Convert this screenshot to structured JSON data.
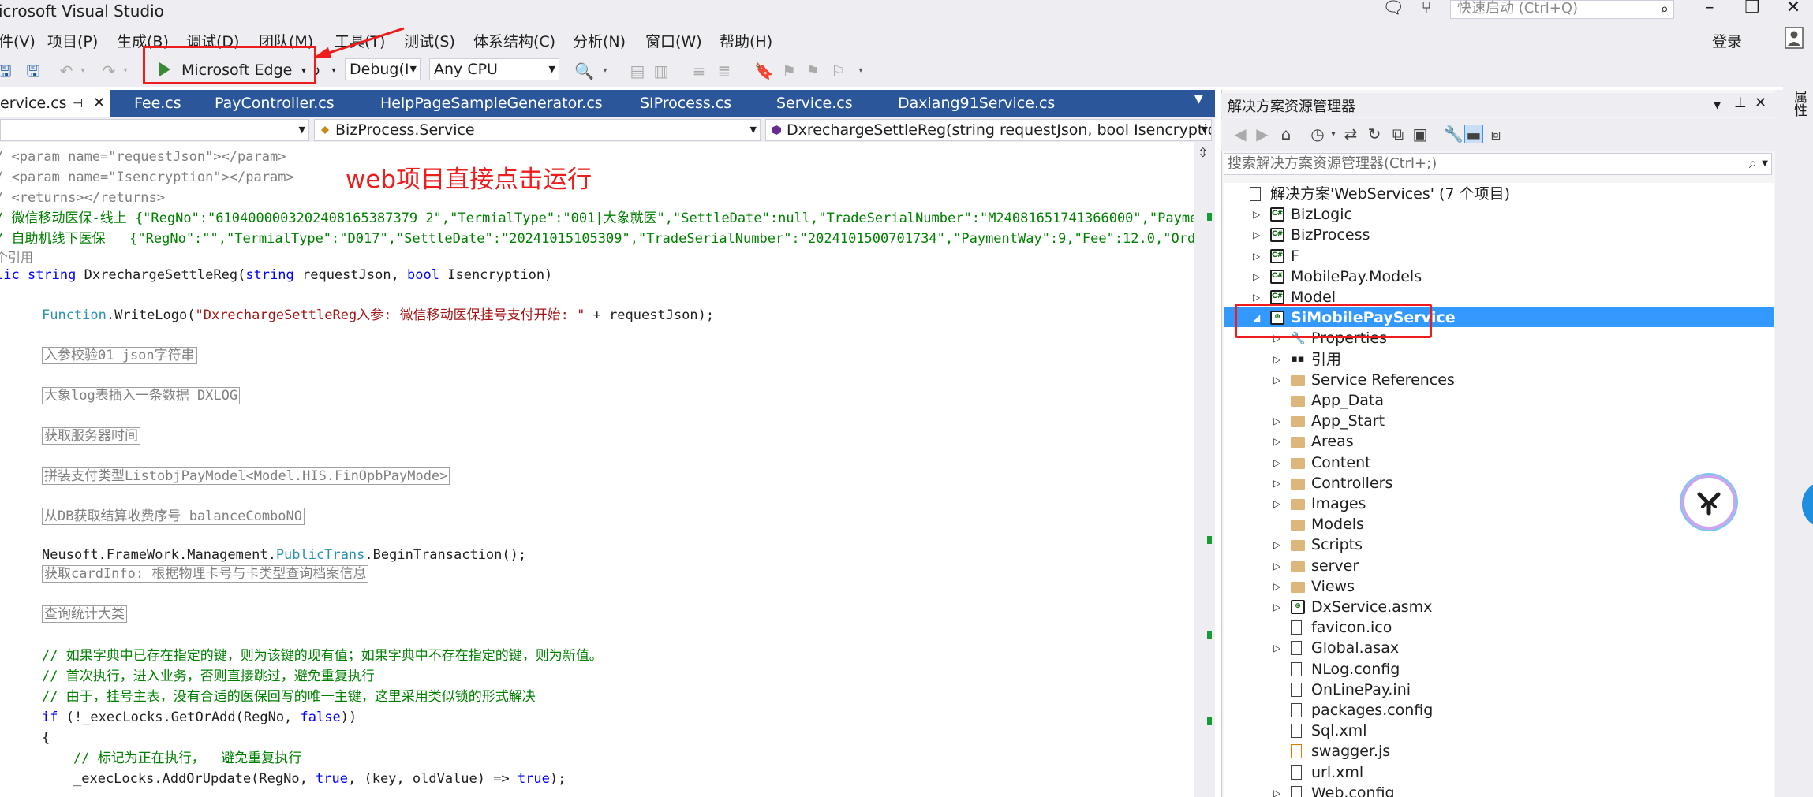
{
  "window": {
    "title": "icrosoft Visual Studio",
    "quick_launch_placeholder": "快速启动 (Ctrl+Q)",
    "login": "登录"
  },
  "menu": [
    "件(V)",
    "项目(P)",
    "生成(B)",
    "调试(D)",
    "团队(M)",
    "工具(T)",
    "测试(S)",
    "体系结构(C)",
    "分析(N)",
    "窗口(W)",
    "帮助(H)"
  ],
  "toolbar": {
    "run_label": "Microsoft Edge",
    "config": "Debug(I",
    "platform": "Any CPU"
  },
  "annotation": "web项目直接点击运行",
  "tabs": [
    "ervice.cs",
    "Fee.cs",
    "PayController.cs",
    "HelpPageSampleGenerator.cs",
    "SIProcess.cs",
    "Service.cs",
    "Daxiang91Service.cs"
  ],
  "navbar": {
    "project": "",
    "class": "BizProcess.Service",
    "member": "DxrechargeSettleReg(string requestJson, bool Isencryption)"
  },
  "code": {
    "l1": "/ <param name=\"requestJson\"></param>",
    "l2": "/ <param name=\"Isencryption\"></param>",
    "l3": "/ <returns></returns>",
    "l4": "/ 微信移动医保-线上 {\"RegNo\":\"6104000003202408165387379 2\",\"TermialType\":\"001|大象就医\",\"SettleDate\":null,\"TradeSerialNumber\":\"M24081651741366000\",\"Payme",
    "l5": "/ 自助机线下医保   {\"RegNo\":\"\",\"TermialType\":\"D017\",\"SettleDate\":\"20241015105309\",\"TradeSerialNumber\":\"2024101500701734\",\"PaymentWay\":9,\"Fee\":12.0,\"Orde",
    "l6": "个引用",
    "l7_kw1": "lic",
    "l7_kw2": "string",
    "l7_name": " DxrechargeSettleReg(",
    "l7_kw3": "string",
    "l7_mid": " requestJson, ",
    "l7_kw4": "bool",
    "l7_end": " Isencryption)",
    "l8_type": "Function",
    "l8_call": ".WriteLogo(",
    "l8_str": "\"DxrechargeSettleReg入参: 微信移动医保挂号支付开始: \"",
    "l8_end": " + requestJson);",
    "r1": "入参校验01 json字符串",
    "r2": "大象log表插入一条数据 DXLOG",
    "r3": "获取服务器时间",
    "r4": "拼装支付类型ListobjPayModel<Model.HIS.FinOpbPayMode>",
    "r5": "从DB获取结算收费序号 balanceComboNO",
    "l9_a": "Neusoft.FrameWork.Management.",
    "l9_type": "PublicTrans",
    "l9_b": ".BeginTransaction();",
    "r6": "获取cardInfo: 根据物理卡号与卡类型查询档案信息",
    "r7": "查询统计大类",
    "c1": "// 如果字典中已存在指定的键，则为该键的现有值；如果字典中不存在指定的键，则为新值。",
    "c2": "// 首次执行，进入业务，否则直接跳过，避免重复执行",
    "c3": "// 由于，挂号主表，没有合适的医保回写的唯一主键，这里采用类似锁的形式解决",
    "l10_kw": "if",
    "l10_a": " (!_execLocks.GetOrAdd(RegNo, ",
    "l10_kw2": "false",
    "l10_b": "))",
    "l11": "{",
    "c4": "// 标记为正在执行，  避免重复执行",
    "l12_a": "_execLocks.AddOrUpdate(RegNo, ",
    "l12_kw": "true",
    "l12_b": ", (key, oldValue) => ",
    "l12_kw2": "true",
    "l12_c": ");"
  },
  "solution_explorer": {
    "title": "解决方案资源管理器",
    "search_placeholder": "搜索解决方案资源管理器(Ctrl+;)",
    "solution": "解决方案'WebServices' (7 个项目)",
    "projects": [
      "BizLogic",
      "BizProcess",
      "F",
      "MobilePay.Models",
      "Model",
      "SiMobilePayService"
    ],
    "children": [
      "Properties",
      "引用",
      "Service References",
      "App_Data",
      "App_Start",
      "Areas",
      "Content",
      "Controllers",
      "Images",
      "Models",
      "Scripts",
      "server",
      "Views",
      "DxService.asmx",
      "favicon.ico",
      "Global.asax",
      "NLog.config",
      "OnLinePay.ini",
      "packages.config",
      "Sql.xml",
      "swagger.js",
      "url.xml",
      "Web.config"
    ]
  },
  "right_strip_label": "属性"
}
